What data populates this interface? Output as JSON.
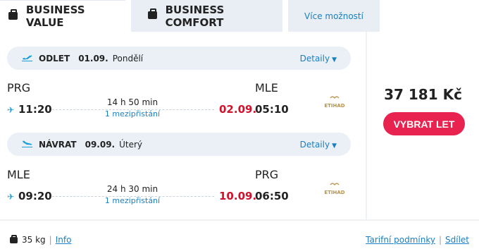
{
  "tabs": {
    "value_label": "BUSINESS VALUE",
    "comfort_label": "BUSINESS COMFORT",
    "more_label": "Více možností"
  },
  "outbound": {
    "type_label": "ODLET",
    "date": "01.09.",
    "weekday": "Pondělí",
    "details_label": "Detaily",
    "from_code": "PRG",
    "to_code": "MLE",
    "dep_time": "11:20",
    "arr_date": "02.09.",
    "arr_time": "05:10",
    "duration": "14 h 50 min",
    "stops": "1 mezipřistání",
    "airline_logo_text": "ETIHAD"
  },
  "inbound": {
    "type_label": "NÁVRAT",
    "date": "09.09.",
    "weekday": "Úterý",
    "details_label": "Detaily",
    "from_code": "MLE",
    "to_code": "PRG",
    "dep_time": "09:20",
    "arr_date": "10.09.",
    "arr_time": "06:50",
    "duration": "24 h 30 min",
    "stops": "1 mezipřistání",
    "airline_logo_text": "ETIHAD"
  },
  "price": "37 181 Kč",
  "select_label": "VYBRAT LET",
  "footer": {
    "baggage": "35 kg",
    "info_label": "Info",
    "conditions_label": "Tarifní podmínky",
    "share_label": "Sdílet"
  },
  "colors": {
    "accent_blue": "#1a7fc1",
    "plane_blue": "#1a9fd9",
    "cta_red": "#e8234f",
    "arrival_date_red": "#d0122d",
    "logo_gold": "#b8934a"
  },
  "icons": {
    "tab_icon": "suitcase-icon",
    "outbound_icon": "plane-takeoff-icon",
    "inbound_icon": "plane-landing-icon",
    "small_plane": "plane-icon",
    "baggage_icon": "suitcase-icon"
  }
}
